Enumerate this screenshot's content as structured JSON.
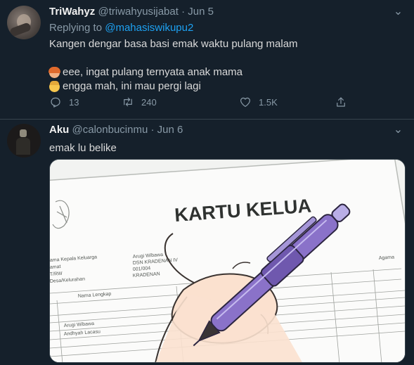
{
  "tweets": [
    {
      "name": "TriWahyz",
      "handle": "@triwahyusijabat",
      "separator": "·",
      "date": "Jun 5",
      "replying_prefix": "Replying to",
      "replying_to": "@mahasiswikupu2",
      "text_line1": "Kangen dengar basa basi emak waktu pulang malam",
      "dialog": [
        {
          "emoji": "woman-emoji-icon",
          "text": "eee, ingat pulang ternyata anak mama"
        },
        {
          "emoji": "boy-emoji-icon",
          "text": "engga mah, ini mau pergi lagi"
        }
      ],
      "counts": {
        "replies": "13",
        "retweets": "240",
        "likes": "1.5K"
      }
    },
    {
      "name": "Aku",
      "handle": "@calonbucinmu",
      "separator": "·",
      "date": "Jun 6",
      "text": "emak lu belike",
      "image": {
        "heading": "KARTU KELUA",
        "heading_tail": "RGA",
        "form_lines": [
          "ama Kepala Keluarga",
          "amat",
          "T/RW",
          "Desa/Kelurahan",
          "Nama Lengkap"
        ],
        "form_values": [
          "Arugi Wibawa",
          "DSN KRADENAN IV",
          "001/004",
          "KRADENAN"
        ],
        "rows": [
          "Arugi Wibawa",
          "Andhyah Lacasu"
        ],
        "col_header": "Agama"
      }
    }
  ],
  "colors": {
    "background": "#15202b",
    "border": "#38444d",
    "muted": "#8899a6",
    "link": "#1da1f2",
    "pen": "#8a72c9"
  }
}
